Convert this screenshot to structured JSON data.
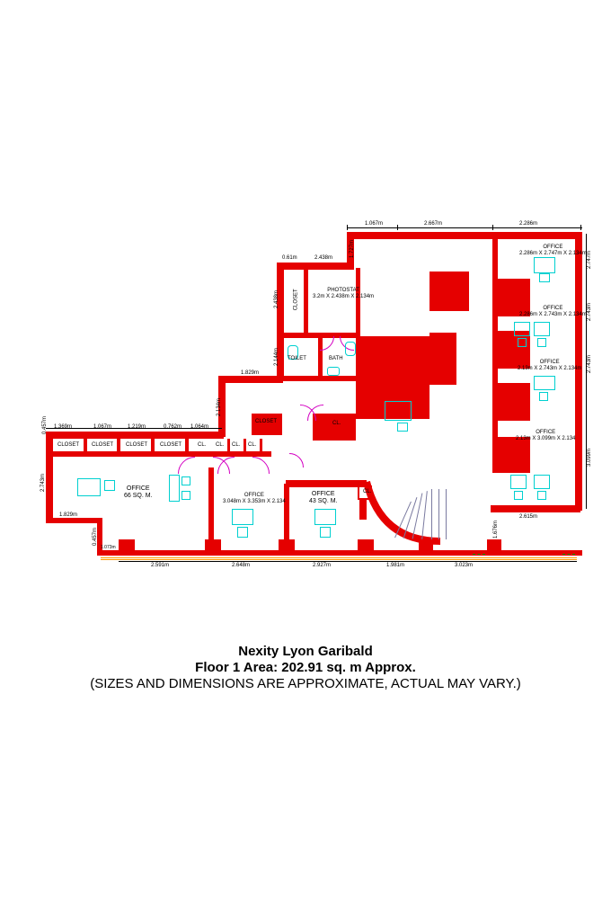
{
  "title": {
    "line1": "Nexity Lyon Garibald",
    "line2": "Floor 1 Area: 202.91 sq. m Approx.",
    "line3": "(SIZES AND DIMENSIONS ARE APPROXIMATE, ACTUAL MAY VARY.)"
  },
  "rooms": {
    "office66": {
      "label": "OFFICE",
      "area": "66 SQ. M."
    },
    "office_b1": {
      "label": "OFFICE",
      "dims": "3.048m X 3.353m X 2.134"
    },
    "office43": {
      "label": "OFFICE",
      "area": "43 SQ. M."
    },
    "office_r1": {
      "label": "OFFICE",
      "dims": "2.286m X 2.747m X 2.134m"
    },
    "office_r2": {
      "label": "OFFICE",
      "dims": "2.286m X 2.743m X 2.134m"
    },
    "office_r3": {
      "label": "OFFICE",
      "dims": "2.13m X 2.743m X 2.134m"
    },
    "office_r4": {
      "label": "OFFICE",
      "dims": "2.13m X 3.099m X 2.134"
    },
    "photostat": {
      "label": "PHOTOSTAT",
      "dims": "3.2m X 2.438m X 2.134m"
    },
    "toilet": {
      "label": "TOILET"
    },
    "bath": {
      "label": "BATH"
    },
    "closet": {
      "c1": "CLOSET",
      "c2": "CLOSET",
      "c3": "CLOSET",
      "c4": "CLOSET",
      "c5": "CLOSET",
      "c6": "CLOSET",
      "cl": "CL."
    }
  },
  "dims": {
    "top": {
      "d1": "1.067m",
      "d2": "2.667m",
      "d3": "2.286m"
    },
    "upper": {
      "d1": "0.61m",
      "d2": "2.438m",
      "v1": "1.727m",
      "v2": "2.438m"
    },
    "mid": {
      "d1": "1.829m",
      "v1": "2.144m",
      "v2": "2.134m"
    },
    "leftTop": {
      "v1": "0.457m",
      "d1": "1.369m",
      "d2": "1.067m",
      "d3": "1.219m",
      "d4": "0.762m",
      "d5": "1.064m"
    },
    "leftSide": {
      "v1": "2.743m",
      "d1": "1.829m",
      "v2": "0.457m",
      "d2": "1.073m"
    },
    "bottom": {
      "d1": "2.591m",
      "d2": "2.648m",
      "d3": "2.927m",
      "d4": "1.981m",
      "d5": "3.023m"
    },
    "right": {
      "v1": "2.747m",
      "v2": "2.743m",
      "v3": "2.743m",
      "v4": "3.099m",
      "d1": "2.615m",
      "v5": "1.676m"
    }
  }
}
